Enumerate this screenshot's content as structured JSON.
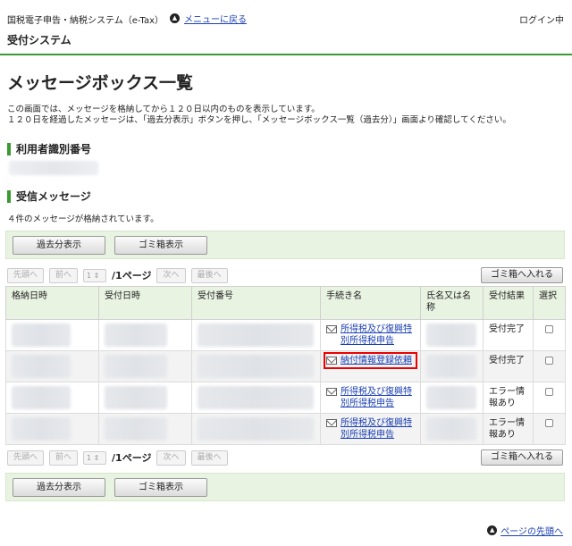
{
  "header": {
    "system_name": "国税電子申告・納税システム（e-Tax）",
    "menu_back": "メニューに戻る",
    "login_status": "ログイン中",
    "system_title": "受付システム"
  },
  "page": {
    "title": "メッセージボックス一覧",
    "desc_line1": "この画面では、メッセージを格納してから１２０日以内のものを表示しています。",
    "desc_line2": "１２０日を経過したメッセージは、「過去分表示」ボタンを押し、「メッセージボックス一覧（過去分）」画面より確認してください。"
  },
  "user_section": {
    "heading": "利用者識別番号"
  },
  "inbox": {
    "heading": "受信メッセージ",
    "count_text": "４件のメッセージが格納されています。",
    "past_button": "過去分表示",
    "trash_view_button": "ゴミ箱表示",
    "pager": {
      "first": "先頭へ",
      "prev": "前へ",
      "page_value": "1",
      "page_info": "/1ページ",
      "next": "次へ",
      "last": "最後へ"
    },
    "move_to_trash": "ゴミ箱へ入れる",
    "columns": [
      "格納日時",
      "受付日時",
      "受付番号",
      "手続き名",
      "氏名又は名称",
      "受付結果",
      "選択"
    ],
    "rows": [
      {
        "procedure": "所得税及び復興特別所得税申告",
        "result": "受付完了",
        "highlighted": false
      },
      {
        "procedure": "納付情報登録依頼",
        "result": "受付完了",
        "highlighted": true
      },
      {
        "procedure": "所得税及び復興特別所得税申告",
        "result": "エラー情報あり",
        "highlighted": false
      },
      {
        "procedure": "所得税及び復興特別所得税申告",
        "result": "エラー情報あり",
        "highlighted": false
      }
    ]
  },
  "footer": {
    "page_top": "ページの先頭へ"
  },
  "colors": {
    "accent_green": "#3a9a2f",
    "panel_green": "#e9f3e2",
    "link_blue": "#1a3fb3",
    "highlight_red": "#ee0000"
  },
  "icons": {
    "menu_back": "chevron-up-circle-icon",
    "procedure": "envelope-icon",
    "page_top": "chevron-up-circle-icon"
  }
}
